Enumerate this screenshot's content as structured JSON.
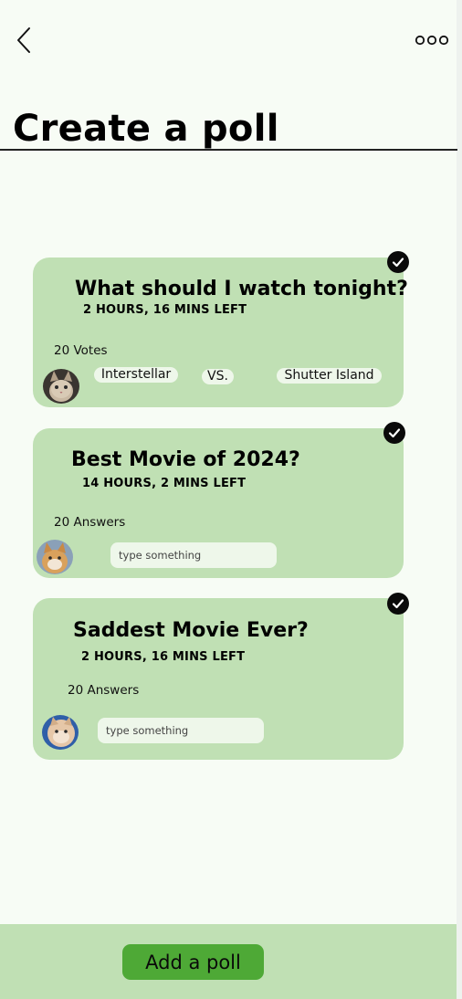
{
  "header": {
    "back_icon": "chevron-left-icon",
    "more_icon": "more-horizontal-icon",
    "title": "Create a poll"
  },
  "polls": [
    {
      "question": "What should I watch tonight?",
      "time_left": "2 HOURS, 16 MINS LEFT",
      "count": "20 Votes",
      "option_a": "Interstellar",
      "vs": "VS.",
      "option_b": "Shutter Island",
      "avatar": "cat-avatar"
    },
    {
      "question": "Best Movie of 2024?",
      "time_left": "14 HOURS, 2 MINS LEFT",
      "count": "20 Answers",
      "input_placeholder": "type something",
      "avatar": "cat-avatar"
    },
    {
      "question": "Saddest Movie Ever?",
      "time_left": "2 HOURS, 16 MINS LEFT",
      "count": "20 Answers",
      "input_placeholder": "type something",
      "avatar": "cat-avatar"
    }
  ],
  "footer": {
    "add_label": "Add a poll"
  },
  "colors": {
    "background": "#f7fcf5",
    "card": "#c0e0b4",
    "accent": "#4ea936",
    "pill": "#eef7ea"
  }
}
